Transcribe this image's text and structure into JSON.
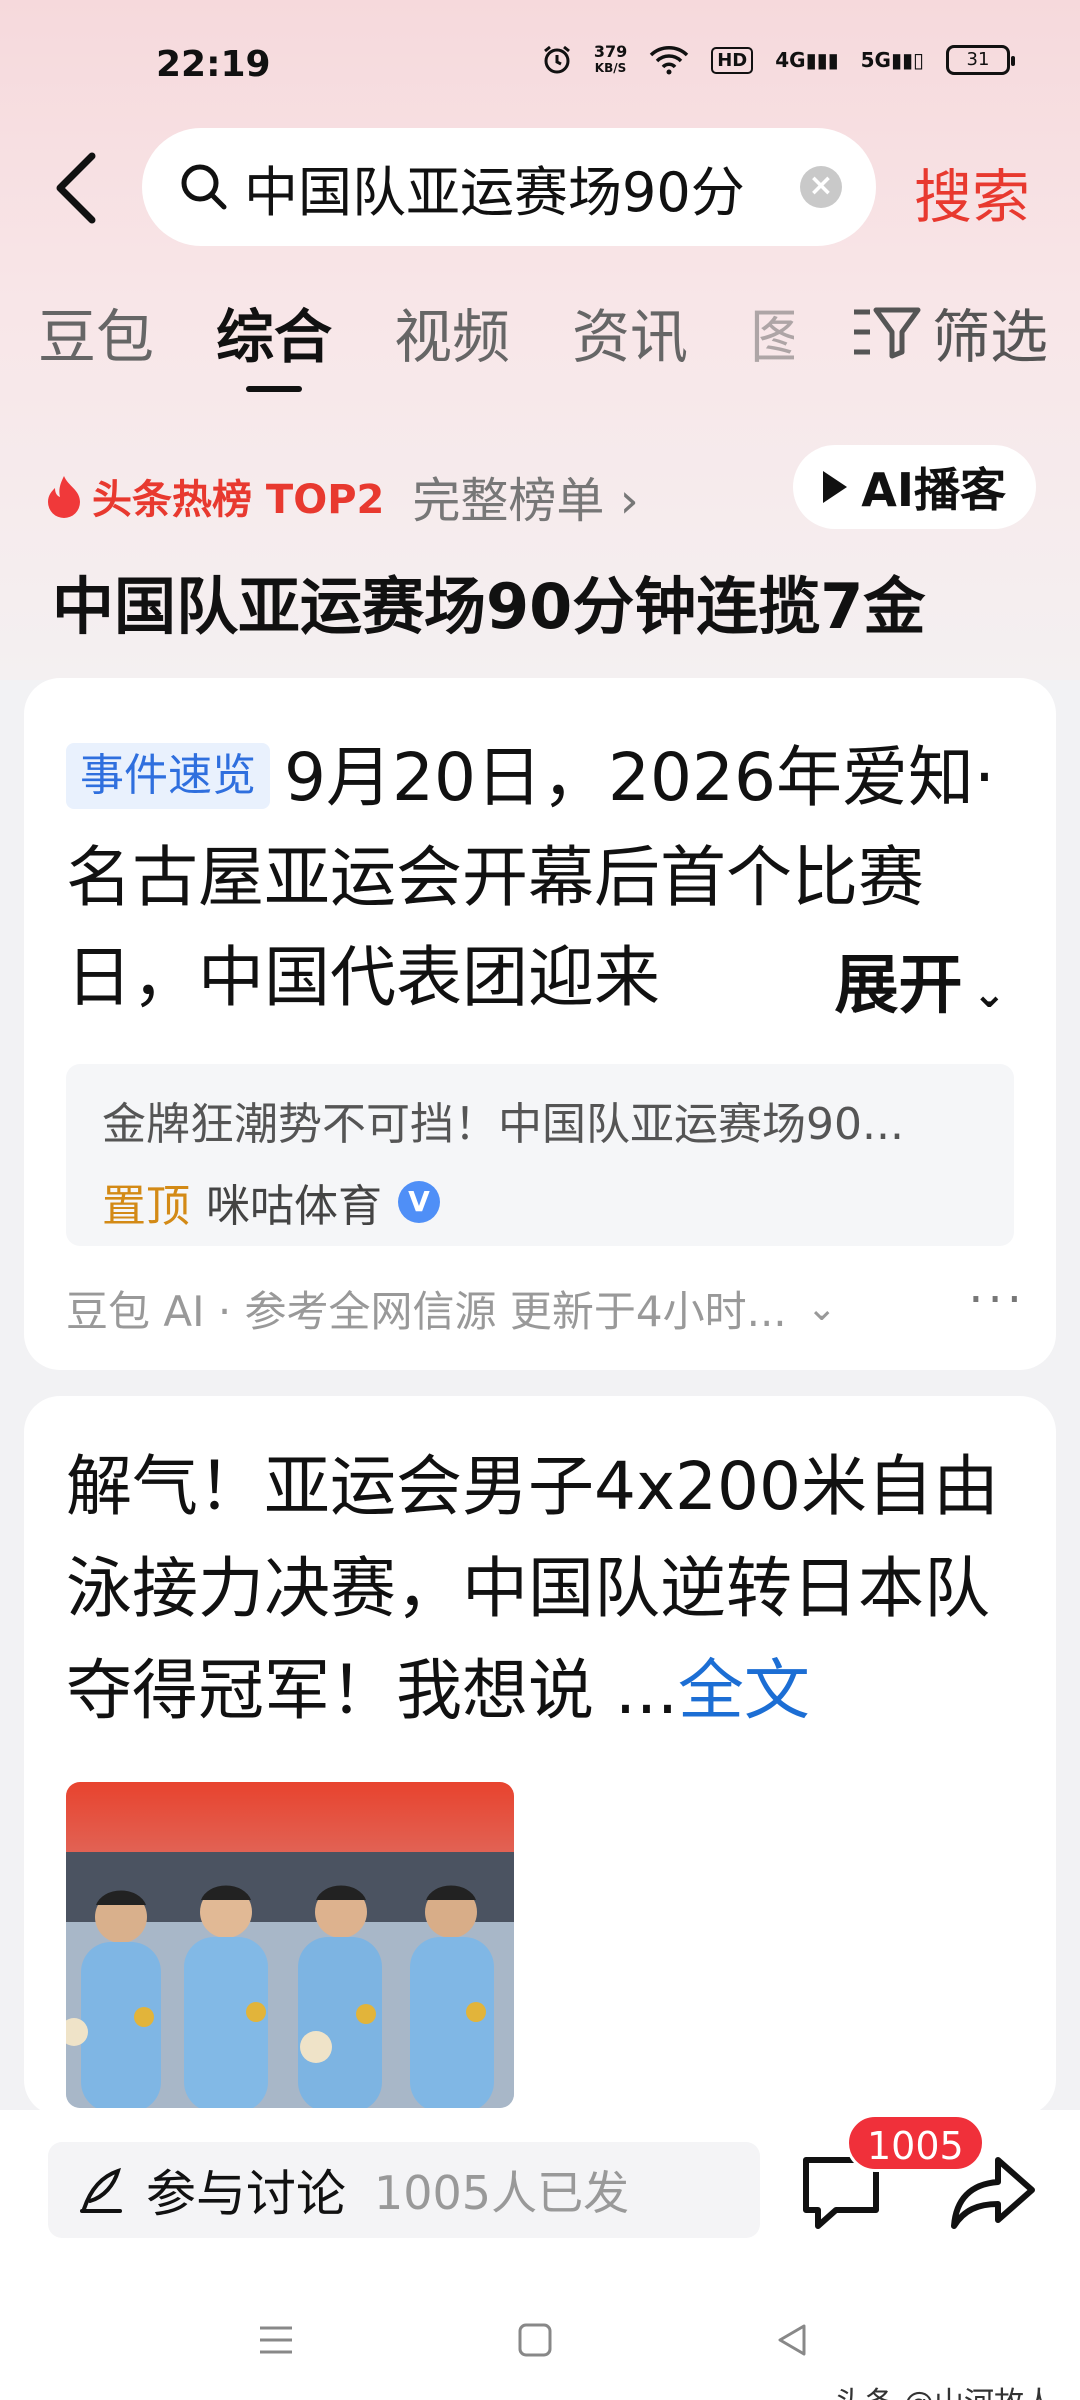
{
  "status_bar": {
    "time": "22:19",
    "net_speed": "379",
    "net_unit": "KB/S",
    "hd": "HD",
    "sig1": "4G",
    "sig2": "5G",
    "battery": "31"
  },
  "search": {
    "query": "中国队亚运赛场90分",
    "button": "搜索"
  },
  "tabs": [
    "豆包",
    "综合",
    "视频",
    "资讯",
    "图"
  ],
  "active_tab": "综合",
  "filter_label": "筛选",
  "hot": {
    "label": "头条热榜 TOP2",
    "full_list": "完整榜单 ›",
    "ai_podcast": "AI播客",
    "title": "中国队亚运赛场90分钟连揽7金"
  },
  "summary_card": {
    "tag": "事件速览",
    "text": "9月20日，2026年爱知·名古屋亚运会开幕后首个比赛日，中国代表团迎来",
    "expand": "展开",
    "source_text": "金牌狂潮势不可挡！中国队亚运赛场90...",
    "pinned": "置顶",
    "source_name": "咪咕体育",
    "verified": "V",
    "footer": "豆包 AI · 参考全网信源 更新于4小时..."
  },
  "article_card": {
    "title": "解气！亚运会男子4x200米自由泳接力决赛，中国队逆转日本队夺得冠军！我想说 ...",
    "full_text": "全文"
  },
  "bottom_bar": {
    "discuss_label": "参与讨论",
    "discuss_count": "1005人已发",
    "comment_badge": "1005"
  },
  "watermark": "头条 @山河故人"
}
